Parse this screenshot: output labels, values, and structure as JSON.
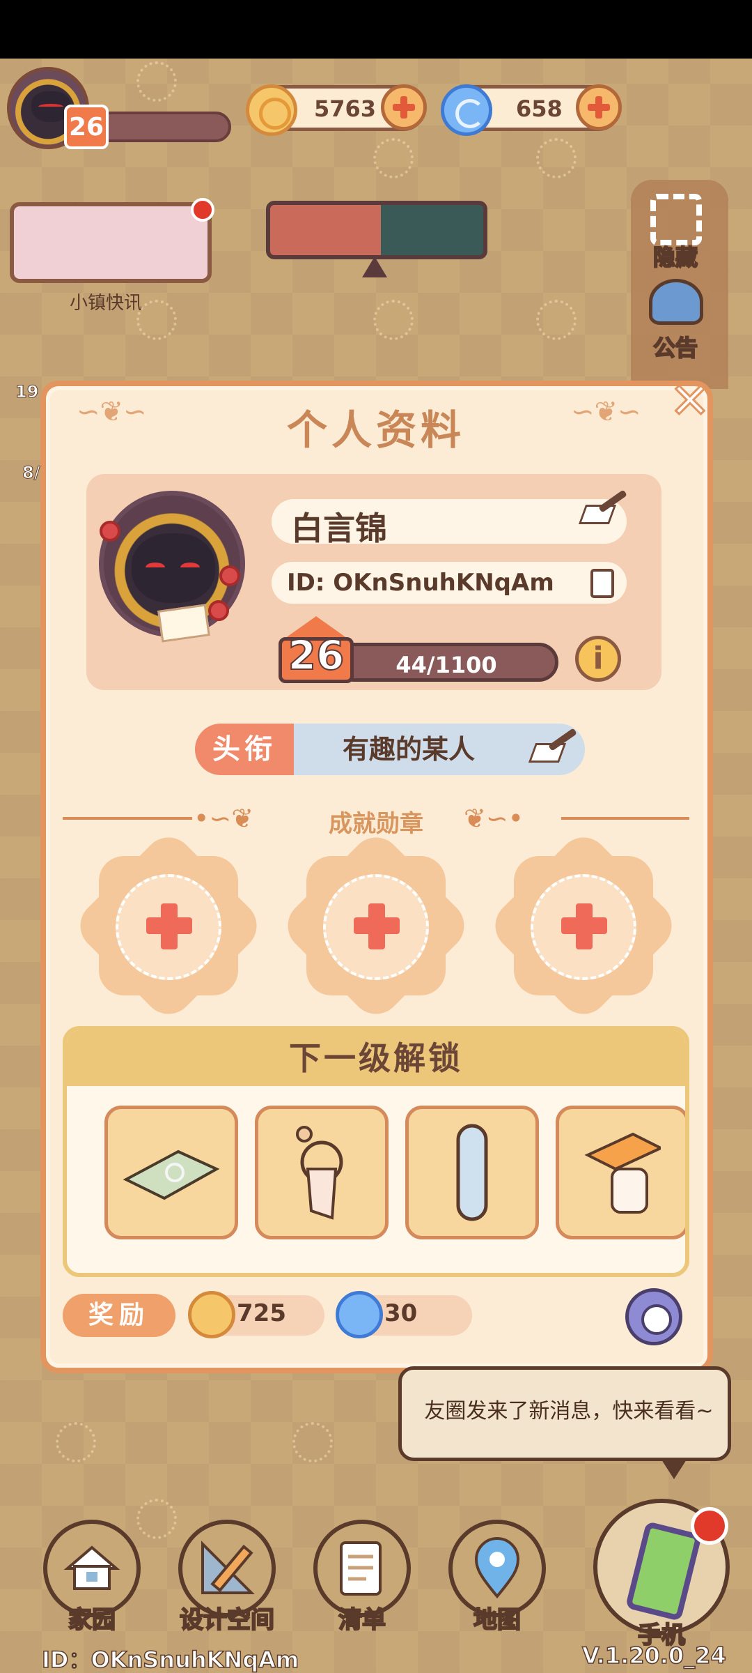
{
  "hud": {
    "player_level": "26",
    "coins": "5763",
    "gems": "658"
  },
  "left_panel": {
    "news_label": "小镇快讯",
    "partial_values": [
      "19",
      "8/"
    ]
  },
  "right_panel": {
    "hide_label": "隐藏",
    "notice_label": "公告"
  },
  "profile": {
    "title": "个人资料",
    "name": "白言锦",
    "id_text": "ID: OKnSnuhKNqAm",
    "level": "26",
    "xp": "44/1100",
    "xp_fraction": 0.04,
    "title_tag_label": "头衔",
    "title_tag_value": "有趣的某人",
    "achievements_label": "成就勋章",
    "next_unlock_label": "下一级解锁",
    "unlock_items": [
      "rug-icon",
      "towel-rack-icon",
      "mirror-icon",
      "paper-holder-icon"
    ],
    "reward_label": "奖励",
    "reward_coins": "725",
    "reward_gems": "30"
  },
  "notification": {
    "text": "友圈发来了新消息，快来看看~"
  },
  "nav": {
    "home": "家园",
    "design": "设计空间",
    "list": "清单",
    "map": "地图",
    "phone": "手机"
  },
  "footer": {
    "id": "ID：OKnSnuhKNqAm",
    "version": "V.1.20.0_24"
  },
  "colors": {
    "accent": "#e2955e",
    "modal_bg": "#fcecd5",
    "badge": "#f07a4a"
  }
}
